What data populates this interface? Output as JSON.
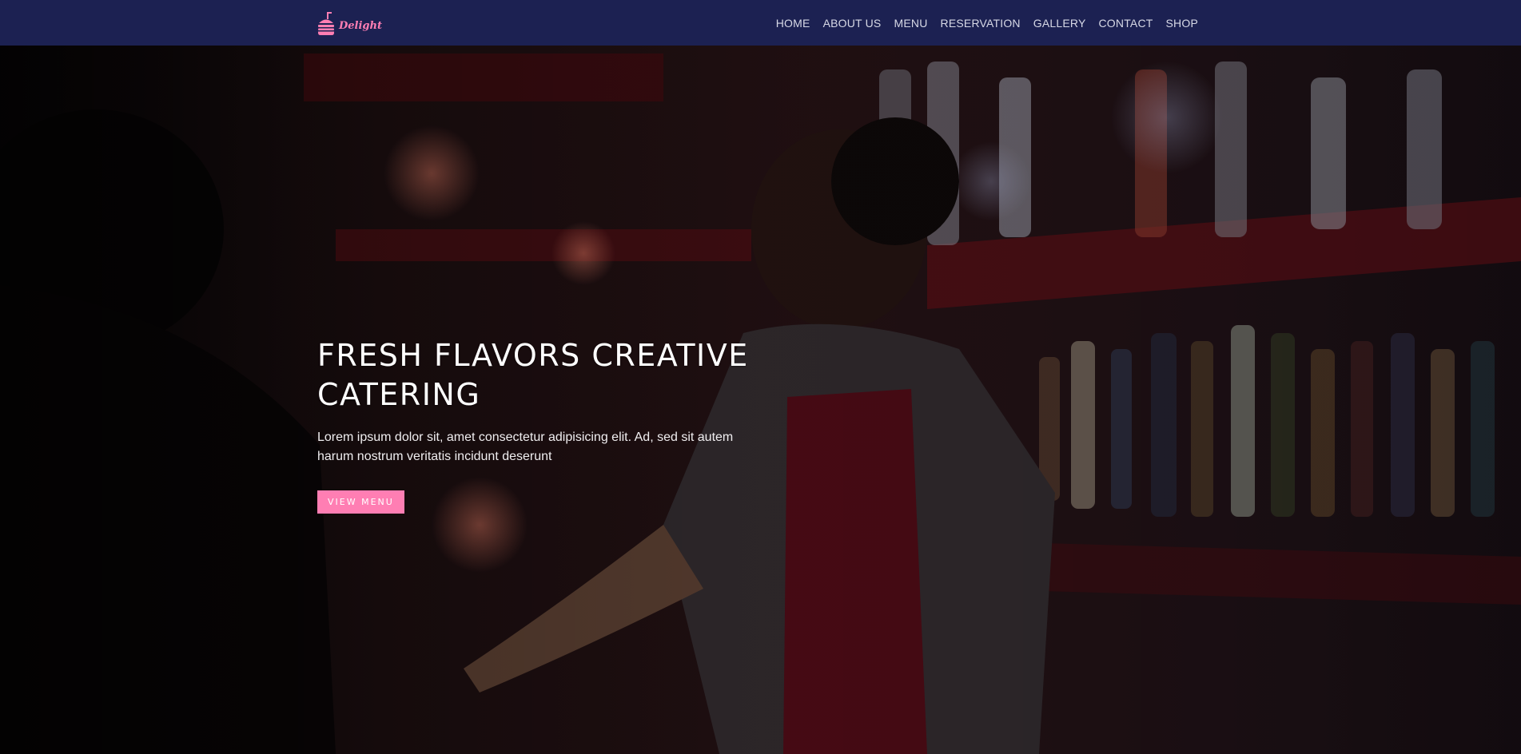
{
  "brand": {
    "name": "Delight",
    "icon": "burger-icon",
    "color": "#ff7eb3"
  },
  "nav": {
    "items": [
      {
        "label": "HOME"
      },
      {
        "label": "ABOUT US"
      },
      {
        "label": "MENU"
      },
      {
        "label": "RESERVATION"
      },
      {
        "label": "GALLERY"
      },
      {
        "label": "CONTACT"
      },
      {
        "label": "SHOP"
      }
    ],
    "background": "#1c2152"
  },
  "hero": {
    "title": "FRESH FLAVORS CREATIVE CATERING",
    "description": "Lorem ipsum dolor sit, amet consectetur adipisicing elit. Ad, sed sit autem harum nostrum veritatis incidunt deserunt",
    "button_label": "VIEW MENU",
    "accent": "#ff7eb3"
  }
}
